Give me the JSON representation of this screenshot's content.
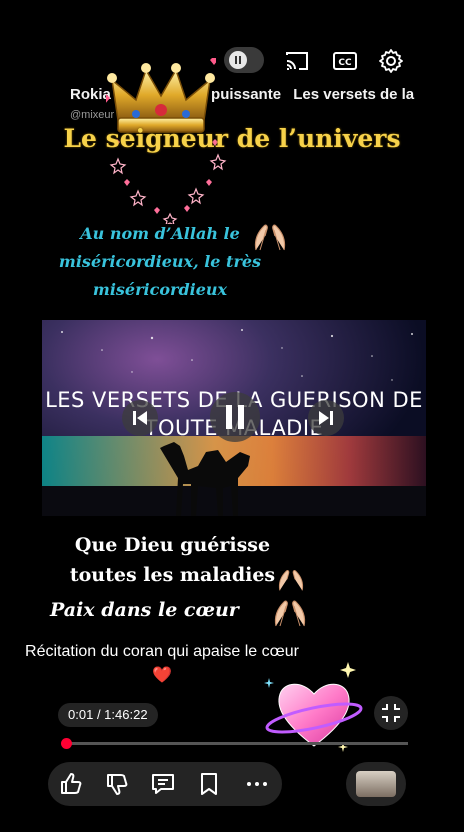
{
  "player": {
    "top_controls": [
      "pause-toggle",
      "cast-icon",
      "cc-icon",
      "gear-icon"
    ],
    "marquee_items": [
      "Rokia",
      "puissante",
      "Les versets de la"
    ],
    "channel_handle": "@mixeur"
  },
  "overlay": {
    "title": "Le seigneur de l’univers",
    "bismillah": "Au nom d’Allah le miséricordieux, le très miséricordieux",
    "line1": "Que Dieu guérisse",
    "line2": "toutes les maladies",
    "paix": "Paix dans le cœur",
    "recitation": "Récitation du coran qui apaise le cœur",
    "heart_emoji": "❤️"
  },
  "video": {
    "title": "LES VERSETS DE LA GUERISON DE TOUTE MALADIE",
    "controls": [
      "previous",
      "pause",
      "next"
    ]
  },
  "playback": {
    "current_time": "0:01",
    "duration": "1:46:22",
    "time_display": "0:01 / 1:46:22",
    "progress_fraction": 0.0002
  },
  "actions": [
    "like",
    "dislike",
    "comment",
    "save",
    "more"
  ],
  "colors": {
    "title_yellow": "#f7d24a",
    "bismillah_cyan": "#39c3dc",
    "progress_red": "#ff0033"
  }
}
